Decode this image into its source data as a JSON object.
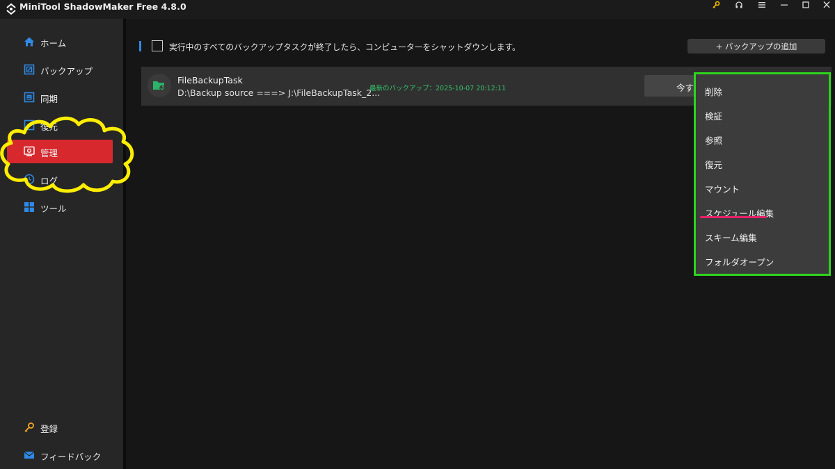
{
  "app": {
    "title": "MiniTool ShadowMaker Free 4.8.0",
    "titlebar_icons": [
      "key-icon",
      "headset-icon",
      "menu-icon",
      "minimize-icon",
      "maximize-icon",
      "close-icon"
    ]
  },
  "sidebar": {
    "items": [
      {
        "label": "ホーム",
        "icon": "home-icon"
      },
      {
        "label": "バックアップ",
        "icon": "backup-icon"
      },
      {
        "label": "同期",
        "icon": "sync-icon"
      },
      {
        "label": "復元",
        "icon": "restore-icon"
      },
      {
        "label": "管理",
        "icon": "manage-icon",
        "active": true
      },
      {
        "label": "ログ",
        "icon": "log-icon"
      },
      {
        "label": "ツール",
        "icon": "tools-icon"
      }
    ],
    "bottom": [
      {
        "label": "登録",
        "icon": "key-icon"
      },
      {
        "label": "フィードバック",
        "icon": "mail-icon"
      }
    ]
  },
  "main": {
    "shutdown_label": "実行中のすべてのバックアップタスクが終了したら、コンピューターをシャットダウンします。",
    "add_backup_label": "+ バックアップの追加",
    "task": {
      "name": "FileBackupTask",
      "path": "D:\\Backup source ===> J:\\FileBackupTask_2...",
      "last_backup": "最新のバックアップ：2025-10-07 20:12:11",
      "backup_now_label": "今す"
    }
  },
  "context_menu": {
    "items": [
      "削除",
      "検証",
      "参照",
      "復元",
      "マウント",
      "スケジュール編集",
      "スキーム編集",
      "フォルダオープン"
    ]
  },
  "colors": {
    "active_nav": "#d6282d",
    "menu_highlight": "#2ed41e",
    "annotation_cloud": "#ffee00",
    "underline": "#e62167",
    "accent": "#2f89e6",
    "last_backup_text": "#36c26b"
  }
}
